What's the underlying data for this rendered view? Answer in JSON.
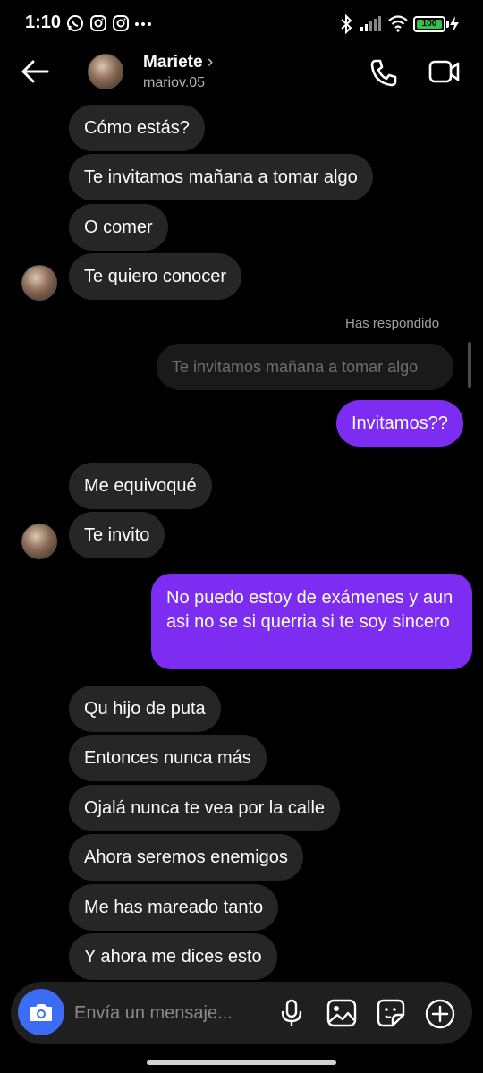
{
  "status_bar": {
    "time": "1:10",
    "battery": "100",
    "icons": [
      "whatsapp-icon",
      "instagram-icon",
      "instagram-icon",
      "more-dots-icon",
      "bluetooth-icon",
      "signal-icon",
      "wifi-icon",
      "battery-icon",
      "charging-icon"
    ]
  },
  "header": {
    "name": "Mariete",
    "name_chevron": "›",
    "username": "mariov.05",
    "icons": [
      "back-arrow-icon",
      "phone-icon",
      "video-call-icon"
    ]
  },
  "messages": [
    {
      "side": "in",
      "text": "Cómo estás?"
    },
    {
      "side": "in",
      "text": "Te invitamos mañana a tomar algo"
    },
    {
      "side": "in",
      "text": "O comer"
    },
    {
      "side": "in",
      "text": "Te quiero conocer"
    },
    {
      "side": "note",
      "text": "Has respondido"
    },
    {
      "side": "reply-quote",
      "text": "Te invitamos mañana a tomar algo"
    },
    {
      "side": "out",
      "text": "Invitamos??"
    },
    {
      "side": "in",
      "text": "Me equivoqué"
    },
    {
      "side": "in",
      "text": "Te invito"
    },
    {
      "side": "out",
      "text": "No puedo estoy de exámenes y aun asi no se si querria si te soy sincero"
    },
    {
      "side": "in",
      "text": "Qu hijo de puta"
    },
    {
      "side": "in",
      "text": "Entonces nunca más"
    },
    {
      "side": "in",
      "text": "Ojalá nunca te vea por la calle"
    },
    {
      "side": "in",
      "text": "Ahora seremos enemigos"
    },
    {
      "side": "in",
      "text": "Me has mareado tanto"
    },
    {
      "side": "in",
      "text": "Y ahora me dices esto"
    }
  ],
  "composer": {
    "placeholder": "Envía un mensaje...",
    "icons": [
      "camera-icon",
      "microphone-icon",
      "gallery-icon",
      "sticker-icon",
      "add-icon"
    ]
  },
  "colors": {
    "incoming_bubble": "#262626",
    "outgoing_bubble": "#7d2cf2",
    "camera_button": "#3b6cf3",
    "background": "#000000"
  }
}
